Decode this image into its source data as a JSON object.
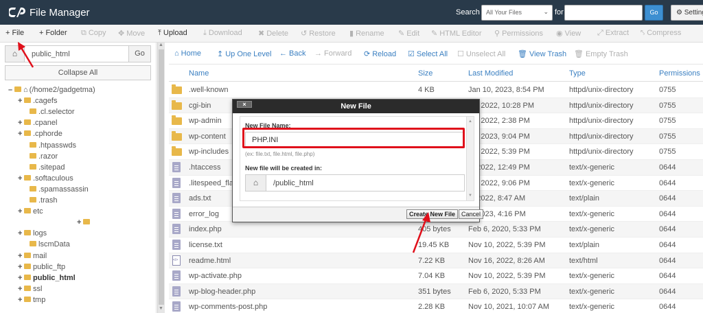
{
  "header": {
    "app_title": "File Manager",
    "search_label": "Search",
    "search_scope": "All Your Files",
    "for_label": "for",
    "search_value": "",
    "go_label": "Go",
    "settings_label": "Settings",
    "brand_color": "#293a4a"
  },
  "toolbar": {
    "file": "File",
    "folder": "Folder",
    "copy": "Copy",
    "move": "Move",
    "upload": "Upload",
    "download": "Download",
    "delete": "Delete",
    "restore": "Restore",
    "rename": "Rename",
    "edit": "Edit",
    "html_editor": "HTML Editor",
    "permissions": "Permissions",
    "view": "View",
    "extract": "Extract",
    "compress": "Compress"
  },
  "sidebar": {
    "path_value": "public_html",
    "go_label": "Go",
    "collapse_label": "Collapse All",
    "tree": [
      {
        "label": "(/home2/gadgetma)",
        "prefix": "–",
        "home": true
      },
      {
        "label": ".cagefs",
        "prefix": "+"
      },
      {
        "label": ".cl.selector",
        "prefix": ""
      },
      {
        "label": ".cpanel",
        "prefix": "+"
      },
      {
        "label": ".cphorde",
        "prefix": "+"
      },
      {
        "label": ".htpasswds",
        "prefix": ""
      },
      {
        "label": ".razor",
        "prefix": ""
      },
      {
        "label": ".sitepad",
        "prefix": ""
      },
      {
        "label": ".softaculous",
        "prefix": "+"
      },
      {
        "label": ".spamassassin",
        "prefix": ""
      },
      {
        "label": ".trash",
        "prefix": ""
      },
      {
        "label": "etc",
        "prefix": "+"
      },
      {
        "label": "",
        "prefix": "+"
      },
      {
        "label": "logs",
        "prefix": "+"
      },
      {
        "label": "lscmData",
        "prefix": ""
      },
      {
        "label": "mail",
        "prefix": "+"
      },
      {
        "label": "public_ftp",
        "prefix": "+"
      },
      {
        "label": "public_html",
        "prefix": "+",
        "bold": true
      },
      {
        "label": "ssl",
        "prefix": "+"
      },
      {
        "label": "tmp",
        "prefix": "+"
      }
    ]
  },
  "nav": {
    "home": "Home",
    "up": "Up One Level",
    "back": "Back",
    "forward": "Forward",
    "reload": "Reload",
    "select_all": "Select All",
    "unselect_all": "Unselect All",
    "view_trash": "View Trash",
    "empty_trash": "Empty Trash"
  },
  "table": {
    "columns": [
      "Name",
      "Size",
      "Last Modified",
      "Type",
      "Permissions"
    ],
    "rows": [
      {
        "icon": "dir",
        "name": ".well-known",
        "size": "4 KB",
        "modified": "Jan 10, 2023, 8:54 PM",
        "type": "httpd/unix-directory",
        "perms": "0755"
      },
      {
        "icon": "dir",
        "name": "cgi-bin",
        "size": "",
        "modified": "29, 2022, 10:28 PM",
        "type": "httpd/unix-directory",
        "perms": "0755"
      },
      {
        "icon": "dir",
        "name": "wp-admin",
        "size": "",
        "modified": "30, 2022, 2:38 PM",
        "type": "httpd/unix-directory",
        "perms": "0755"
      },
      {
        "icon": "dir",
        "name": "wp-content",
        "size": "",
        "modified": "13, 2023, 9:04 PM",
        "type": "httpd/unix-directory",
        "perms": "0755"
      },
      {
        "icon": "dir",
        "name": "wp-includes",
        "size": "",
        "modified": "10, 2022, 5:39 PM",
        "type": "httpd/unix-directory",
        "perms": "0755"
      },
      {
        "icon": "file",
        "name": ".htaccess",
        "size": "",
        "modified": "3, 2022, 12:49 PM",
        "type": "text/x-generic",
        "perms": "0644"
      },
      {
        "icon": "file",
        "name": ".litespeed_flag",
        "size": "",
        "modified": "22, 2022, 9:06 PM",
        "type": "text/x-generic",
        "perms": "0644"
      },
      {
        "icon": "file",
        "name": "ads.txt",
        "size": "",
        "modified": "1, 2022, 8:47 AM",
        "type": "text/plain",
        "perms": "0644"
      },
      {
        "icon": "file",
        "name": "error_log",
        "size": "",
        "modified": "4, 2023, 4:16 PM",
        "type": "text/x-generic",
        "perms": "0644"
      },
      {
        "icon": "file",
        "name": "index.php",
        "size": "405 bytes",
        "modified": "Feb 6, 2020, 5:33 PM",
        "type": "text/x-generic",
        "perms": "0644"
      },
      {
        "icon": "file",
        "name": "license.txt",
        "size": "19.45 KB",
        "modified": "Nov 10, 2022, 5:39 PM",
        "type": "text/plain",
        "perms": "0644"
      },
      {
        "icon": "html",
        "name": "readme.html",
        "size": "7.22 KB",
        "modified": "Nov 16, 2022, 8:26 AM",
        "type": "text/html",
        "perms": "0644"
      },
      {
        "icon": "file",
        "name": "wp-activate.php",
        "size": "7.04 KB",
        "modified": "Nov 10, 2022, 5:39 PM",
        "type": "text/x-generic",
        "perms": "0644"
      },
      {
        "icon": "file",
        "name": "wp-blog-header.php",
        "size": "351 bytes",
        "modified": "Feb 6, 2020, 5:33 PM",
        "type": "text/x-generic",
        "perms": "0644"
      },
      {
        "icon": "file",
        "name": "wp-comments-post.php",
        "size": "2.28 KB",
        "modified": "Nov 10, 2021, 10:07 AM",
        "type": "text/x-generic",
        "perms": "0644"
      }
    ]
  },
  "dialog": {
    "title": "New File",
    "close_label": "×",
    "name_label": "New File Name:",
    "name_value": "PHP.INI",
    "hint": "(ex: file.txt, file.html, file.php)",
    "location_label": "New file will be created in:",
    "location_value": "/public_html",
    "create_label": "Create New File",
    "cancel_label": "Cancel"
  },
  "annotation_color": "#e0101b"
}
